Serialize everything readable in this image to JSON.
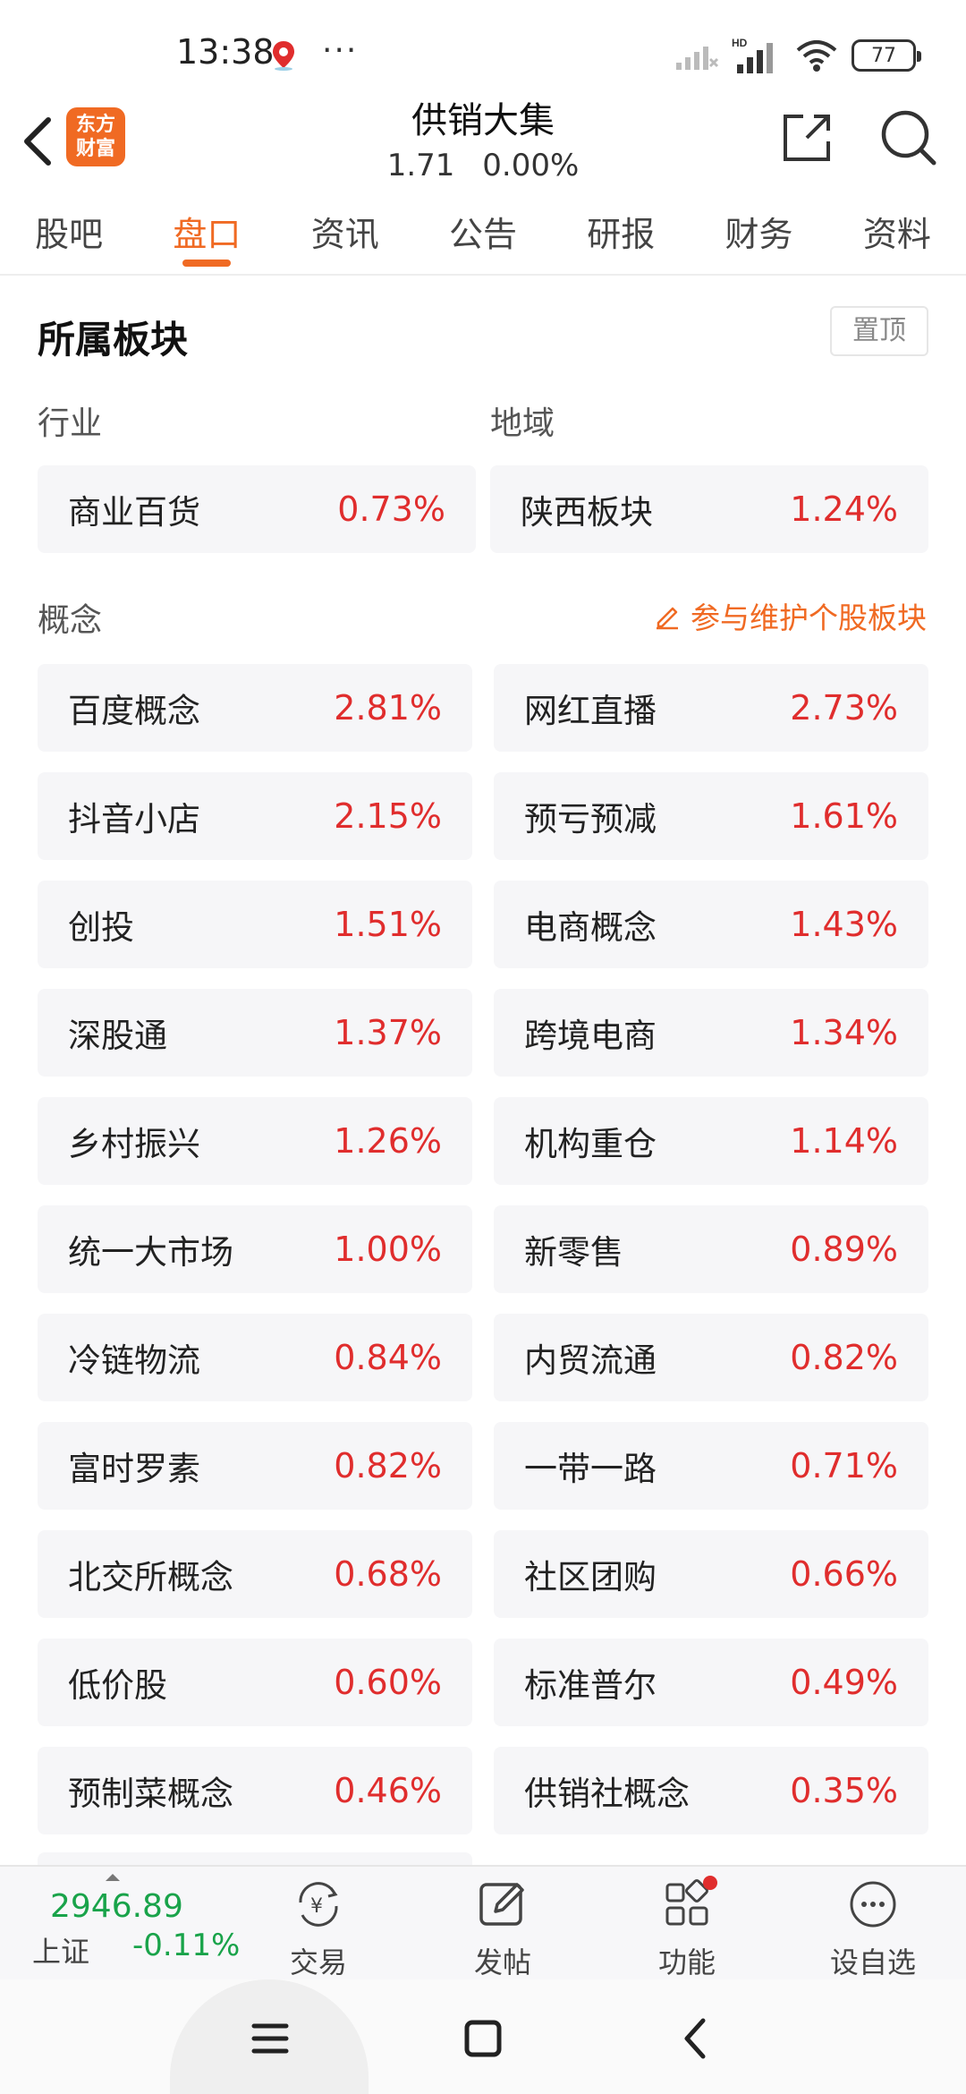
{
  "status_bar": {
    "time": "13:38",
    "dots": "···",
    "battery": "77"
  },
  "header": {
    "logo_line1": "东方",
    "logo_line2": "财富",
    "title": "供销大集",
    "price": "1.71",
    "change": "0.00%"
  },
  "tabs": [
    {
      "label": "股吧"
    },
    {
      "label": "盘口"
    },
    {
      "label": "资讯"
    },
    {
      "label": "公告"
    },
    {
      "label": "研报"
    },
    {
      "label": "财务"
    },
    {
      "label": "资料"
    }
  ],
  "section": {
    "title": "所属板块",
    "pin_label": "置顶",
    "industry_label": "行业",
    "region_label": "地域",
    "concept_label": "概念",
    "maintain_link": "参与维护个股板块"
  },
  "industry": {
    "name": "商业百货",
    "pct": "0.73%"
  },
  "region": {
    "name": "陕西板块",
    "pct": "1.24%"
  },
  "concepts": [
    {
      "name": "百度概念",
      "pct": "2.81%"
    },
    {
      "name": "网红直播",
      "pct": "2.73%"
    },
    {
      "name": "抖音小店",
      "pct": "2.15%"
    },
    {
      "name": "预亏预减",
      "pct": "1.61%"
    },
    {
      "name": "创投",
      "pct": "1.51%"
    },
    {
      "name": "电商概念",
      "pct": "1.43%"
    },
    {
      "name": "深股通",
      "pct": "1.37%"
    },
    {
      "name": "跨境电商",
      "pct": "1.34%"
    },
    {
      "name": "乡村振兴",
      "pct": "1.26%"
    },
    {
      "name": "机构重仓",
      "pct": "1.14%"
    },
    {
      "name": "统一大市场",
      "pct": "1.00%"
    },
    {
      "name": "新零售",
      "pct": "0.89%"
    },
    {
      "name": "冷链物流",
      "pct": "0.84%"
    },
    {
      "name": "内贸流通",
      "pct": "0.82%"
    },
    {
      "name": "富时罗素",
      "pct": "0.82%"
    },
    {
      "name": "一带一路",
      "pct": "0.71%"
    },
    {
      "name": "北交所概念",
      "pct": "0.68%"
    },
    {
      "name": "社区团购",
      "pct": "0.66%"
    },
    {
      "name": "低价股",
      "pct": "0.60%"
    },
    {
      "name": "标准普尔",
      "pct": "0.49%"
    },
    {
      "name": "预制菜概念",
      "pct": "0.46%"
    },
    {
      "name": "供销社概念",
      "pct": "0.35%"
    }
  ],
  "bottom_bar": {
    "index_value": "2946.89",
    "index_name": "上证",
    "index_change": "-0.11%",
    "trade_label": "交易",
    "post_label": "发帖",
    "func_label": "功能",
    "watch_label": "设自选"
  },
  "colors": {
    "accent": "#f06a23",
    "up": "#e02d2d",
    "down": "#19a34a"
  }
}
